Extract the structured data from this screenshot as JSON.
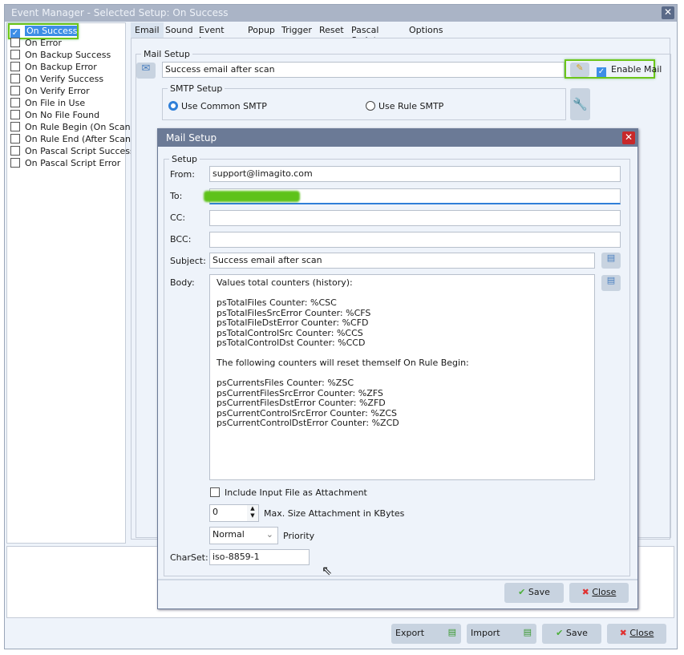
{
  "window": {
    "title": "Event Manager - Selected Setup: On Success",
    "close": "✕"
  },
  "events": [
    {
      "label": "On Success",
      "checked": true,
      "selected": true
    },
    {
      "label": "On Error",
      "checked": false
    },
    {
      "label": "On Backup Success",
      "checked": false
    },
    {
      "label": "On Backup Error",
      "checked": false
    },
    {
      "label": "On Verify Success",
      "checked": false
    },
    {
      "label": "On Verify Error",
      "checked": false
    },
    {
      "label": "On File in Use",
      "checked": false
    },
    {
      "label": "On No File Found",
      "checked": false
    },
    {
      "label": "On Rule Begin (On Scan)",
      "checked": false
    },
    {
      "label": "On Rule End (After Scan)",
      "checked": false
    },
    {
      "label": "On Pascal Script Success",
      "checked": false
    },
    {
      "label": "On Pascal Script Error",
      "checked": false
    }
  ],
  "tabs": [
    "Email",
    "Sound",
    "Event Log",
    "Popup",
    "Trigger",
    "Reset",
    "Pascal Script",
    "Options"
  ],
  "active_tab": "Email",
  "mail_setup": {
    "legend": "Mail Setup",
    "name": "Success email after scan",
    "enable_mail": "Enable Mail",
    "enable_checked": true,
    "smtp": {
      "legend": "SMTP Setup",
      "common": "Use Common SMTP",
      "rule": "Use Rule SMTP",
      "selected": "common"
    }
  },
  "dialog": {
    "title": "Mail Setup",
    "close": "✕",
    "legend": "Setup",
    "from_label": "From:",
    "from": "support@limagito.com",
    "to_label": "To:",
    "cc_label": "CC:",
    "bcc_label": "BCC:",
    "subject_label": "Subject:",
    "subject": "Success email after scan",
    "body_label": "Body:",
    "body": "Values total counters (history):\n\npsTotalFiles Counter: %CSC\npsTotalFilesSrcError Counter: %CFS\npsTotalFileDstError Counter: %CFD\npsTotalControlSrc Counter: %CCS\npsTotalControlDst Counter: %CCD\n\nThe following counters will reset themself On Rule Begin:\n\npsCurrentsFiles Counter: %ZSC\npsCurrentFilesSrcError Counter: %ZFS\npsCurrentFilesDstError Counter: %ZFD\npsCurrentControlSrcError Counter: %ZCS\npsCurrentControlDstError Counter: %ZCD",
    "attach_label": "Include Input File as Attachment",
    "attach_checked": false,
    "max_size": "0",
    "max_size_label": "Max. Size Attachment in KBytes",
    "priority": "Normal",
    "priority_label": "Priority",
    "charset_label": "CharSet:",
    "charset": "iso-8859-1",
    "save": "Save",
    "close_btn": "Close"
  },
  "footer": {
    "export": "Export",
    "import": "Import",
    "save": "Save",
    "close": "Close"
  },
  "colors": {
    "accent": "#3d8ee6",
    "highlight": "#6cc51a",
    "dialog_title": "#6b7a96",
    "redaction": "#5ec21a"
  }
}
